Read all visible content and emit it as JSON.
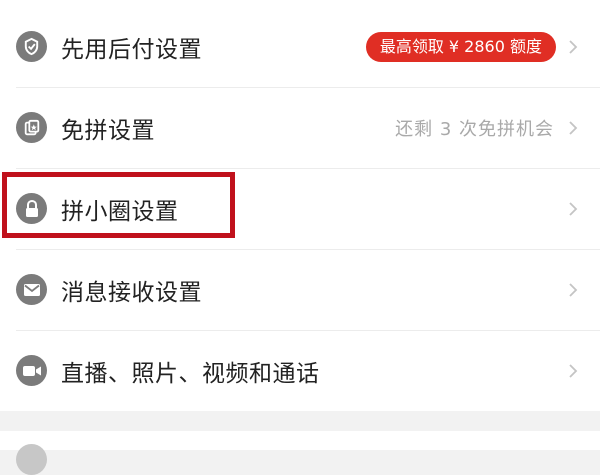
{
  "settings": {
    "items": [
      {
        "icon": "credit-pay-icon",
        "label": "先用后付设置",
        "badge": "最高领取 ¥ 2860 额度",
        "hint": ""
      },
      {
        "icon": "free-group-card-icon",
        "label": "免拼设置",
        "badge": "",
        "hint": "还剩 3 次免拼机会"
      },
      {
        "icon": "lock-icon",
        "label": "拼小圈设置",
        "badge": "",
        "hint": ""
      },
      {
        "icon": "mail-icon",
        "label": "消息接收设置",
        "badge": "",
        "hint": ""
      },
      {
        "icon": "video-camera-icon",
        "label": "直播、照片、视频和通话",
        "badge": "",
        "hint": ""
      }
    ]
  },
  "colors": {
    "badge_bg": "#e02e24",
    "highlight_border": "#c0111c",
    "icon_grey": "#7b7b7b",
    "hint_text": "#a9a9a9"
  }
}
